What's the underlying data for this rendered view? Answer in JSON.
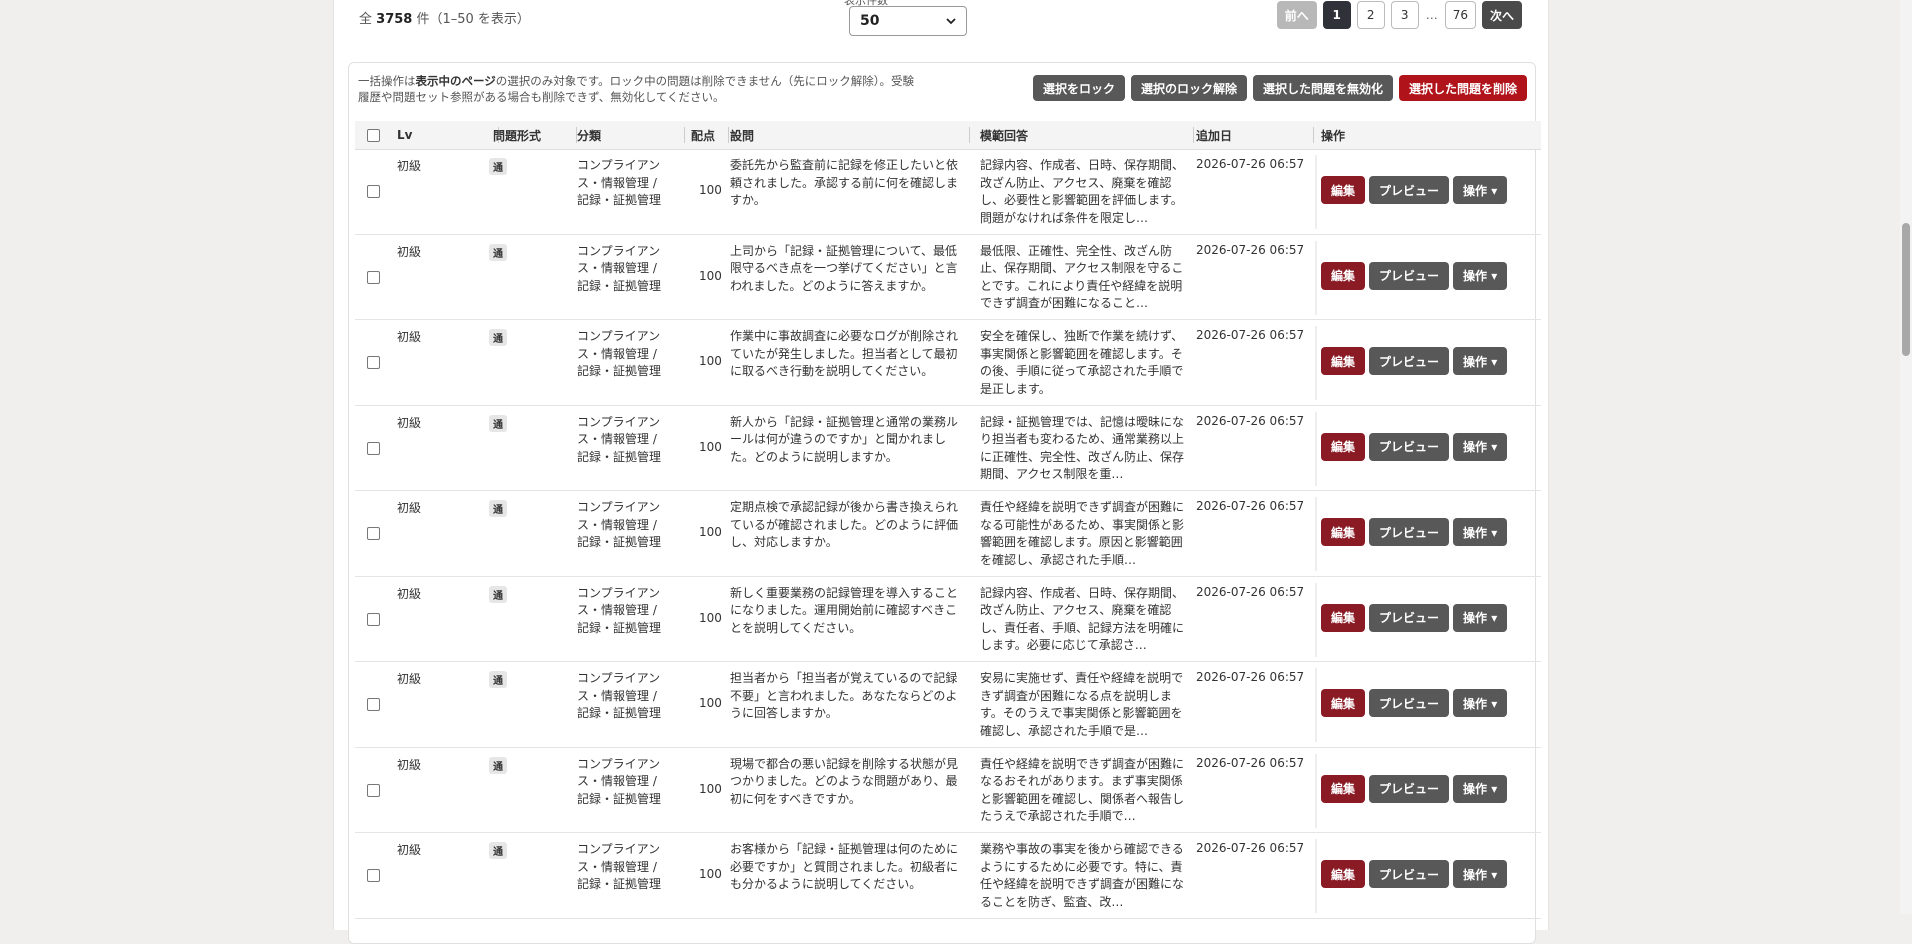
{
  "summary": {
    "prefix": "全",
    "total": "3758",
    "suffix": "件（1–50 を表示）"
  },
  "per_page": {
    "label": "表示件数",
    "value": "50"
  },
  "pagination": {
    "prev": "前へ",
    "pages": [
      "1",
      "2",
      "3"
    ],
    "ellipsis": "…",
    "last": "76",
    "next": "次へ"
  },
  "bulk": {
    "note_a": "一括操作は",
    "note_bold": "表示中のページ",
    "note_b": "の選択のみ対象です。ロック中の問題は削除できません（先にロック解除）。受験履歴や問題セット参照がある場合も削除できず、無効化してください。",
    "lock": "選択をロック",
    "unlock": "選択のロック解除",
    "disable": "選択した問題を無効化",
    "delete": "選択した問題を削除"
  },
  "table": {
    "headers": {
      "lv": "Lv",
      "format": "問題形式",
      "category": "分類",
      "points": "配点",
      "question": "設問",
      "answer": "模範回答",
      "added": "追加日",
      "ops": "操作"
    },
    "buttons": {
      "edit": "編集",
      "preview": "プレビュー",
      "ops": "操作 ▾"
    },
    "rows": [
      {
        "lv": "初級",
        "format": "通",
        "category": "コンプライアンス・情報管理 / 記録・証拠管理",
        "points": "100",
        "question": "委託先から監査前に記録を修正したいと依頼されました。承認する前に何を確認しますか。",
        "answer": "記録内容、作成者、日時、保存期間、改ざん防止、アクセス、廃棄を確認し、必要性と影響範囲を評価します。問題がなければ条件を限定し…",
        "added": "2026-07-26 06:57"
      },
      {
        "lv": "初級",
        "format": "通",
        "category": "コンプライアンス・情報管理 / 記録・証拠管理",
        "points": "100",
        "question": "上司から「記録・証拠管理について、最低限守るべき点を一つ挙げてください」と言われました。どのように答えますか。",
        "answer": "最低限、正確性、完全性、改ざん防止、保存期間、アクセス制限を守ることです。これにより責任や経緯を説明できず調査が困難になること…",
        "added": "2026-07-26 06:57"
      },
      {
        "lv": "初級",
        "format": "通",
        "category": "コンプライアンス・情報管理 / 記録・証拠管理",
        "points": "100",
        "question": "作業中に事故調査に必要なログが削除されていたが発生しました。担当者として最初に取るべき行動を説明してください。",
        "answer": "安全を確保し、独断で作業を続けず、事実関係と影響範囲を確認します。その後、手順に従って承認された手順で是正します。",
        "added": "2026-07-26 06:57"
      },
      {
        "lv": "初級",
        "format": "通",
        "category": "コンプライアンス・情報管理 / 記録・証拠管理",
        "points": "100",
        "question": "新人から「記録・証拠管理と通常の業務ルールは何が違うのですか」と聞かれました。どのように説明しますか。",
        "answer": "記録・証拠管理では、記憶は曖昧になり担当者も変わるため、通常業務以上に正確性、完全性、改ざん防止、保存期間、アクセス制限を重…",
        "added": "2026-07-26 06:57"
      },
      {
        "lv": "初級",
        "format": "通",
        "category": "コンプライアンス・情報管理 / 記録・証拠管理",
        "points": "100",
        "question": "定期点検で承認記録が後から書き換えられているが確認されました。どのように評価し、対応しますか。",
        "answer": "責任や経緯を説明できず調査が困難になる可能性があるため、事実関係と影響範囲を確認します。原因と影響範囲を確認し、承認された手順…",
        "added": "2026-07-26 06:57"
      },
      {
        "lv": "初級",
        "format": "通",
        "category": "コンプライアンス・情報管理 / 記録・証拠管理",
        "points": "100",
        "question": "新しく重要業務の記録管理を導入することになりました。運用開始前に確認すべきことを説明してください。",
        "answer": "記録内容、作成者、日時、保存期間、改ざん防止、アクセス、廃棄を確認し、責任者、手順、記録方法を明確にします。必要に応じて承認さ…",
        "added": "2026-07-26 06:57"
      },
      {
        "lv": "初級",
        "format": "通",
        "category": "コンプライアンス・情報管理 / 記録・証拠管理",
        "points": "100",
        "question": "担当者から「担当者が覚えているので記録不要」と言われました。あなたならどのように回答しますか。",
        "answer": "安易に実施せず、責任や経緯を説明できず調査が困難になる点を説明します。そのうえで事実関係と影響範囲を確認し、承認された手順で是…",
        "added": "2026-07-26 06:57"
      },
      {
        "lv": "初級",
        "format": "通",
        "category": "コンプライアンス・情報管理 / 記録・証拠管理",
        "points": "100",
        "question": "現場で都合の悪い記録を削除する状態が見つかりました。どのような問題があり、最初に何をすべきですか。",
        "answer": "責任や経緯を説明できず調査が困難になるおそれがあります。まず事実関係と影響範囲を確認し、関係者へ報告したうえで承認された手順で…",
        "added": "2026-07-26 06:57"
      },
      {
        "lv": "初級",
        "format": "通",
        "category": "コンプライアンス・情報管理 / 記録・証拠管理",
        "points": "100",
        "question": "お客様から「記録・証拠管理は何のために必要ですか」と質問されました。初級者にも分かるように説明してください。",
        "answer": "業務や事故の事実を後から確認できるようにするために必要です。特に、責任や経緯を説明できず調査が困難になることを防ぎ、監査、改…",
        "added": "2026-07-26 06:57"
      }
    ]
  }
}
